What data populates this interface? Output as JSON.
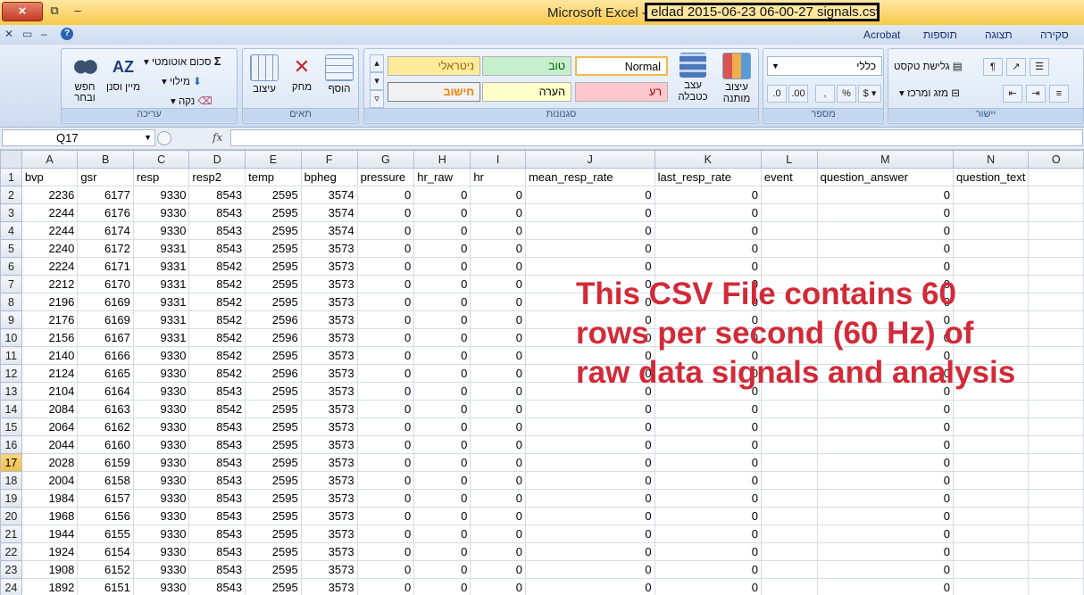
{
  "title_bar": {
    "app_title": "Microsoft Excel -",
    "file_name": "eldad 2015-06-23 06-00-27 signals.csv",
    "close_glyph": "×"
  },
  "ribbon_tabs": [
    "סקירה",
    "תצוגה",
    "תוספות",
    "Acrobat"
  ],
  "ribbon": {
    "editing": {
      "label": "עריכה",
      "find_select": "חפש ובחר",
      "sort_filter": "מיין וסנן",
      "autosum": "סכום אוטומטי",
      "fill": "מילוי",
      "clear": "נקה"
    },
    "cells": {
      "label": "תאים",
      "format": "עיצוב",
      "delete": "מחק",
      "insert": "הוסף"
    },
    "styles": {
      "label": "סגנונות",
      "neutral": "ניטראלי",
      "good": "טוב",
      "normal": "Normal",
      "calculation": "חישוב",
      "note": "הערה",
      "bad": "רע",
      "format_as_table": "עצב כטבלה",
      "conditional_formatting": "עיצוב מותנה"
    },
    "number": {
      "label": "מספר",
      "format_value": "כללי"
    },
    "alignment": {
      "label": "יישור",
      "wrap_text": "גלישת טקסט",
      "merge_center": "מזג ומרכז"
    }
  },
  "formula_bar": {
    "name_box": "Q17",
    "fx": "fx",
    "formula": ""
  },
  "columns": [
    "A",
    "B",
    "C",
    "D",
    "E",
    "F",
    "G",
    "H",
    "I",
    "J",
    "K",
    "L",
    "M",
    "N",
    "O"
  ],
  "headers": [
    "bvp",
    "gsr",
    "resp",
    "resp2",
    "temp",
    "bpheg",
    "pressure",
    "hr_raw",
    "hr",
    "mean_resp_rate",
    "last_resp_rate",
    "event",
    "question_answer",
    "question_text",
    ""
  ],
  "rows": [
    [
      "2236",
      "6177",
      "9330",
      "8543",
      "2595",
      "3574",
      "0",
      "0",
      "0",
      "0",
      "0",
      "",
      "0",
      "",
      ""
    ],
    [
      "2244",
      "6176",
      "9330",
      "8543",
      "2595",
      "3574",
      "0",
      "0",
      "0",
      "0",
      "0",
      "",
      "0",
      "",
      ""
    ],
    [
      "2244",
      "6174",
      "9330",
      "8543",
      "2595",
      "3574",
      "0",
      "0",
      "0",
      "0",
      "0",
      "",
      "0",
      "",
      ""
    ],
    [
      "2240",
      "6172",
      "9331",
      "8543",
      "2595",
      "3573",
      "0",
      "0",
      "0",
      "0",
      "0",
      "",
      "0",
      "",
      ""
    ],
    [
      "2224",
      "6171",
      "9331",
      "8542",
      "2595",
      "3573",
      "0",
      "0",
      "0",
      "0",
      "0",
      "",
      "0",
      "",
      ""
    ],
    [
      "2212",
      "6170",
      "9331",
      "8542",
      "2595",
      "3573",
      "0",
      "0",
      "0",
      "0",
      "0",
      "",
      "0",
      "",
      ""
    ],
    [
      "2196",
      "6169",
      "9331",
      "8542",
      "2595",
      "3573",
      "0",
      "0",
      "0",
      "0",
      "0",
      "",
      "0",
      "",
      ""
    ],
    [
      "2176",
      "6169",
      "9331",
      "8542",
      "2596",
      "3573",
      "0",
      "0",
      "0",
      "0",
      "0",
      "",
      "0",
      "",
      ""
    ],
    [
      "2156",
      "6167",
      "9331",
      "8542",
      "2596",
      "3573",
      "0",
      "0",
      "0",
      "0",
      "0",
      "",
      "0",
      "",
      ""
    ],
    [
      "2140",
      "6166",
      "9330",
      "8542",
      "2595",
      "3573",
      "0",
      "0",
      "0",
      "0",
      "0",
      "",
      "0",
      "",
      ""
    ],
    [
      "2124",
      "6165",
      "9330",
      "8542",
      "2596",
      "3573",
      "0",
      "0",
      "0",
      "0",
      "0",
      "",
      "0",
      "",
      ""
    ],
    [
      "2104",
      "6164",
      "9330",
      "8543",
      "2595",
      "3573",
      "0",
      "0",
      "0",
      "0",
      "0",
      "",
      "0",
      "",
      ""
    ],
    [
      "2084",
      "6163",
      "9330",
      "8542",
      "2595",
      "3573",
      "0",
      "0",
      "0",
      "0",
      "0",
      "",
      "0",
      "",
      ""
    ],
    [
      "2064",
      "6162",
      "9330",
      "8543",
      "2595",
      "3573",
      "0",
      "0",
      "0",
      "0",
      "0",
      "",
      "0",
      "",
      ""
    ],
    [
      "2044",
      "6160",
      "9330",
      "8543",
      "2595",
      "3573",
      "0",
      "0",
      "0",
      "0",
      "0",
      "",
      "0",
      "",
      ""
    ],
    [
      "2028",
      "6159",
      "9330",
      "8543",
      "2595",
      "3573",
      "0",
      "0",
      "0",
      "0",
      "0",
      "",
      "0",
      "",
      ""
    ],
    [
      "2004",
      "6158",
      "9330",
      "8543",
      "2595",
      "3573",
      "0",
      "0",
      "0",
      "0",
      "0",
      "",
      "0",
      "",
      ""
    ],
    [
      "1984",
      "6157",
      "9330",
      "8543",
      "2595",
      "3573",
      "0",
      "0",
      "0",
      "0",
      "0",
      "",
      "0",
      "",
      ""
    ],
    [
      "1968",
      "6156",
      "9330",
      "8543",
      "2595",
      "3573",
      "0",
      "0",
      "0",
      "0",
      "0",
      "",
      "0",
      "",
      ""
    ],
    [
      "1944",
      "6155",
      "9330",
      "8543",
      "2595",
      "3573",
      "0",
      "0",
      "0",
      "0",
      "0",
      "",
      "0",
      "",
      ""
    ],
    [
      "1924",
      "6154",
      "9330",
      "8543",
      "2595",
      "3573",
      "0",
      "0",
      "0",
      "0",
      "0",
      "",
      "0",
      "",
      ""
    ],
    [
      "1908",
      "6152",
      "9330",
      "8543",
      "2595",
      "3573",
      "0",
      "0",
      "0",
      "0",
      "0",
      "",
      "0",
      "",
      ""
    ],
    [
      "1892",
      "6151",
      "9330",
      "8543",
      "2595",
      "3573",
      "0",
      "0",
      "0",
      "0",
      "0",
      "",
      "0",
      "",
      ""
    ]
  ],
  "active_row": 17,
  "overlay_lines": [
    "This CSV File contains 60",
    "rows per second (60 Hz) of",
    "raw data signals and analysis"
  ],
  "colors": {
    "overlay_text": "#d22a38",
    "style_neutral": "#ffeb9c",
    "style_good": "#c6efce",
    "style_bad": "#ffc7ce",
    "style_note": "#ffffcc",
    "calc_text": "#fa7d00"
  }
}
